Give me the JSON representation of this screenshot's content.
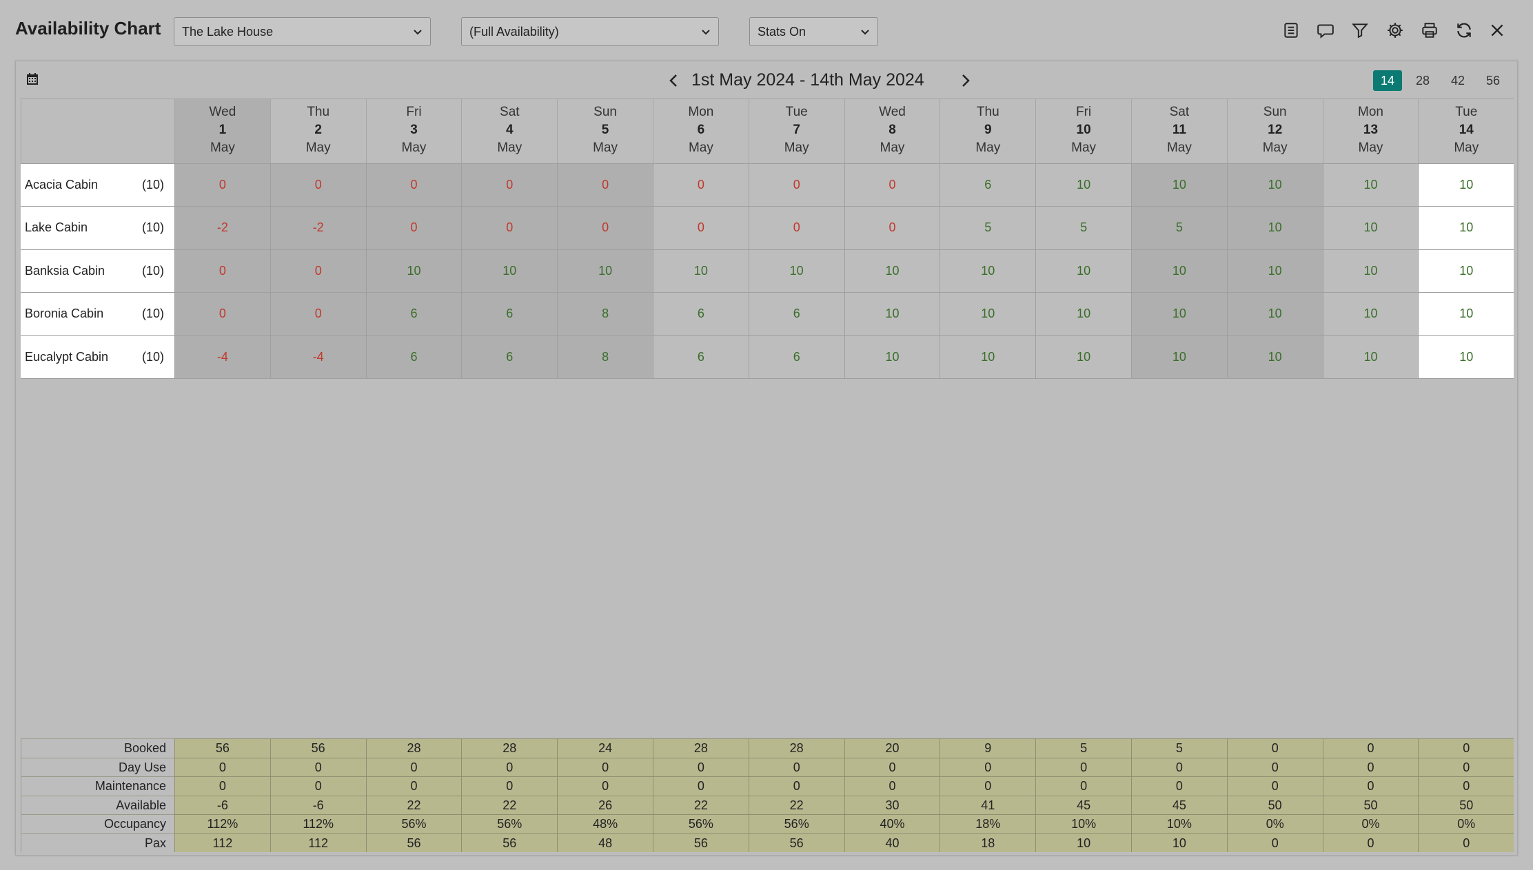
{
  "header": {
    "title": "Availability Chart",
    "property_select": "The Lake House",
    "view_select": "(Full Availability)",
    "stats_select": "Stats On"
  },
  "toolbar": [
    "list-icon",
    "comment-icon",
    "filter-icon",
    "gear-icon",
    "printer-icon",
    "refresh-icon",
    "close-icon"
  ],
  "range": {
    "title": "1st May 2024 - 14th May 2024",
    "span_options": [
      "14",
      "28",
      "42",
      "56"
    ],
    "active_span": "14"
  },
  "days": [
    {
      "dow": "Wed",
      "num": "1",
      "month": "May"
    },
    {
      "dow": "Thu",
      "num": "2",
      "month": "May"
    },
    {
      "dow": "Fri",
      "num": "3",
      "month": "May"
    },
    {
      "dow": "Sat",
      "num": "4",
      "month": "May"
    },
    {
      "dow": "Sun",
      "num": "5",
      "month": "May"
    },
    {
      "dow": "Mon",
      "num": "6",
      "month": "May"
    },
    {
      "dow": "Tue",
      "num": "7",
      "month": "May"
    },
    {
      "dow": "Wed",
      "num": "8",
      "month": "May"
    },
    {
      "dow": "Thu",
      "num": "9",
      "month": "May"
    },
    {
      "dow": "Fri",
      "num": "10",
      "month": "May"
    },
    {
      "dow": "Sat",
      "num": "11",
      "month": "May"
    },
    {
      "dow": "Sun",
      "num": "12",
      "month": "May"
    },
    {
      "dow": "Mon",
      "num": "13",
      "month": "May"
    },
    {
      "dow": "Tue",
      "num": "14",
      "month": "May"
    }
  ],
  "rooms": [
    {
      "name": "Acacia Cabin",
      "count": "(10)",
      "values": [
        "0",
        "0",
        "0",
        "0",
        "0",
        "0",
        "0",
        "0",
        "6",
        "10",
        "10",
        "10",
        "10",
        "10"
      ]
    },
    {
      "name": "Lake Cabin",
      "count": "(10)",
      "values": [
        "-2",
        "-2",
        "0",
        "0",
        "0",
        "0",
        "0",
        "0",
        "5",
        "5",
        "5",
        "10",
        "10",
        "10"
      ]
    },
    {
      "name": "Banksia Cabin",
      "count": "(10)",
      "values": [
        "0",
        "0",
        "10",
        "10",
        "10",
        "10",
        "10",
        "10",
        "10",
        "10",
        "10",
        "10",
        "10",
        "10"
      ]
    },
    {
      "name": "Boronia Cabin",
      "count": "(10)",
      "values": [
        "0",
        "0",
        "6",
        "6",
        "8",
        "6",
        "6",
        "10",
        "10",
        "10",
        "10",
        "10",
        "10",
        "10"
      ]
    },
    {
      "name": "Eucalypt Cabin",
      "count": "(10)",
      "values": [
        "-4",
        "-4",
        "6",
        "6",
        "8",
        "6",
        "6",
        "10",
        "10",
        "10",
        "10",
        "10",
        "10",
        "10"
      ]
    }
  ],
  "stats": [
    {
      "label": "Booked",
      "values": [
        "56",
        "56",
        "28",
        "28",
        "24",
        "28",
        "28",
        "20",
        "9",
        "5",
        "5",
        "0",
        "0",
        "0"
      ]
    },
    {
      "label": "Day Use",
      "values": [
        "0",
        "0",
        "0",
        "0",
        "0",
        "0",
        "0",
        "0",
        "0",
        "0",
        "0",
        "0",
        "0",
        "0"
      ]
    },
    {
      "label": "Maintenance",
      "values": [
        "0",
        "0",
        "0",
        "0",
        "0",
        "0",
        "0",
        "0",
        "0",
        "0",
        "0",
        "0",
        "0",
        "0"
      ]
    },
    {
      "label": "Available",
      "values": [
        "-6",
        "-6",
        "22",
        "22",
        "26",
        "22",
        "22",
        "30",
        "41",
        "45",
        "45",
        "50",
        "50",
        "50"
      ]
    },
    {
      "label": "Occupancy",
      "values": [
        "112%",
        "112%",
        "56%",
        "56%",
        "48%",
        "56%",
        "56%",
        "40%",
        "18%",
        "10%",
        "10%",
        "0%",
        "0%",
        "0%"
      ]
    },
    {
      "label": "Pax",
      "values": [
        "112",
        "112",
        "56",
        "56",
        "48",
        "56",
        "56",
        "40",
        "18",
        "10",
        "10",
        "0",
        "0",
        "0"
      ]
    }
  ],
  "colors": {
    "accent": "#0a7a72",
    "negative": "#c0392b",
    "positive": "#3a6e2a",
    "stats_bg": "#b8b88f"
  }
}
